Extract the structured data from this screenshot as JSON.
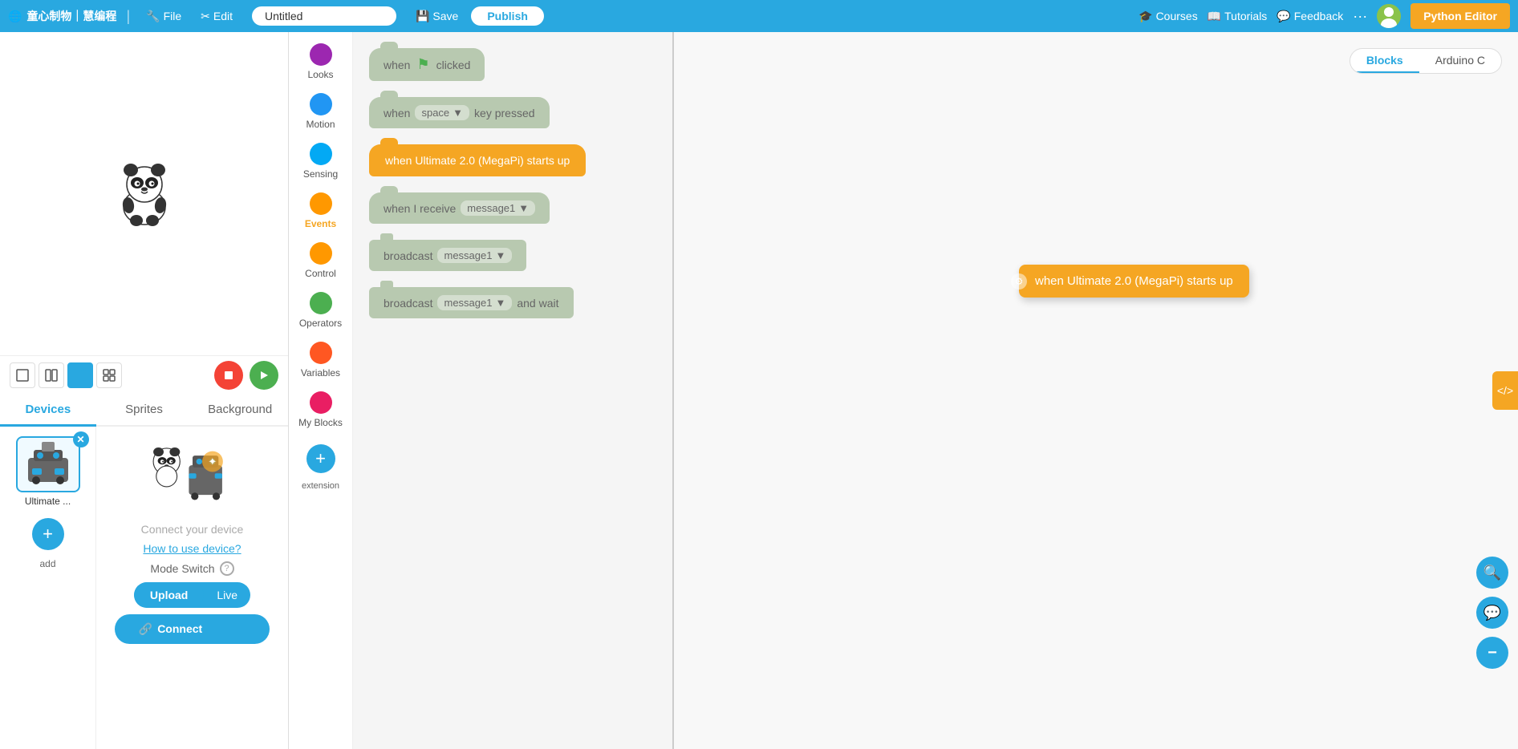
{
  "brand": {
    "logo_text": "童心制物｜慧编程",
    "globe_icon": "🌐"
  },
  "nav": {
    "file_label": "File",
    "edit_label": "Edit",
    "title_placeholder": "Untitled",
    "title_value": "Untitled",
    "save_label": "Save",
    "publish_label": "Publish",
    "courses_label": "Courses",
    "tutorials_label": "Tutorials",
    "feedback_label": "Feedback",
    "more_label": "···",
    "python_editor_label": "Python Editor"
  },
  "stage": {
    "layout_btns": [
      "▢",
      "⊟",
      "⊞",
      "⊠"
    ]
  },
  "tabs": {
    "devices_label": "Devices",
    "sprites_label": "Sprites",
    "background_label": "Background"
  },
  "devices": {
    "item_label": "Ultimate ...",
    "add_label": "add"
  },
  "sprites": {
    "connect_text": "Connect your device",
    "how_link": "How to use device?",
    "mode_switch_label": "Mode Switch",
    "upload_label": "Upload",
    "live_label": "Live",
    "connect_label": "Connect"
  },
  "categories": [
    {
      "id": "looks",
      "label": "Looks",
      "color": "#9C27B0"
    },
    {
      "id": "motion",
      "label": "Motion",
      "color": "#2196F3"
    },
    {
      "id": "sensing",
      "label": "Sensing",
      "color": "#03A9F4"
    },
    {
      "id": "events",
      "label": "Events",
      "color": "#FF9800",
      "active": true
    },
    {
      "id": "control",
      "label": "Control",
      "color": "#FF9800"
    },
    {
      "id": "operators",
      "label": "Operators",
      "color": "#4CAF50"
    },
    {
      "id": "variables",
      "label": "Variables",
      "color": "#FF5722"
    },
    {
      "id": "myblocks",
      "label": "My Blocks",
      "color": "#E91E63"
    }
  ],
  "blocks": [
    {
      "id": "flag_clicked",
      "type": "hat_gray",
      "text": "when",
      "icon": "flag",
      "suffix": "clicked"
    },
    {
      "id": "key_pressed",
      "type": "hat_gray",
      "text": "when",
      "dropdown": "space",
      "suffix": "key pressed"
    },
    {
      "id": "device_startup",
      "type": "hat_yellow",
      "text": "when Ultimate 2.0  (MegaPi)  starts up"
    },
    {
      "id": "receive",
      "type": "gray",
      "text": "when I receive",
      "dropdown": "message1"
    },
    {
      "id": "broadcast",
      "type": "gray",
      "text": "broadcast",
      "dropdown": "message1"
    },
    {
      "id": "broadcast_wait",
      "type": "gray",
      "text": "broadcast",
      "dropdown": "message1",
      "suffix": "and wait"
    }
  ],
  "canvas": {
    "blocks_tab": "Blocks",
    "arduino_tab": "Arduino C",
    "floating_block_text": "when Ultimate 2.0  (MegaPi)  starts up"
  },
  "canvas_btns": {
    "zoom_in": "+",
    "zoom_out": "−",
    "center": "⊕",
    "code_toggle": "</>"
  }
}
